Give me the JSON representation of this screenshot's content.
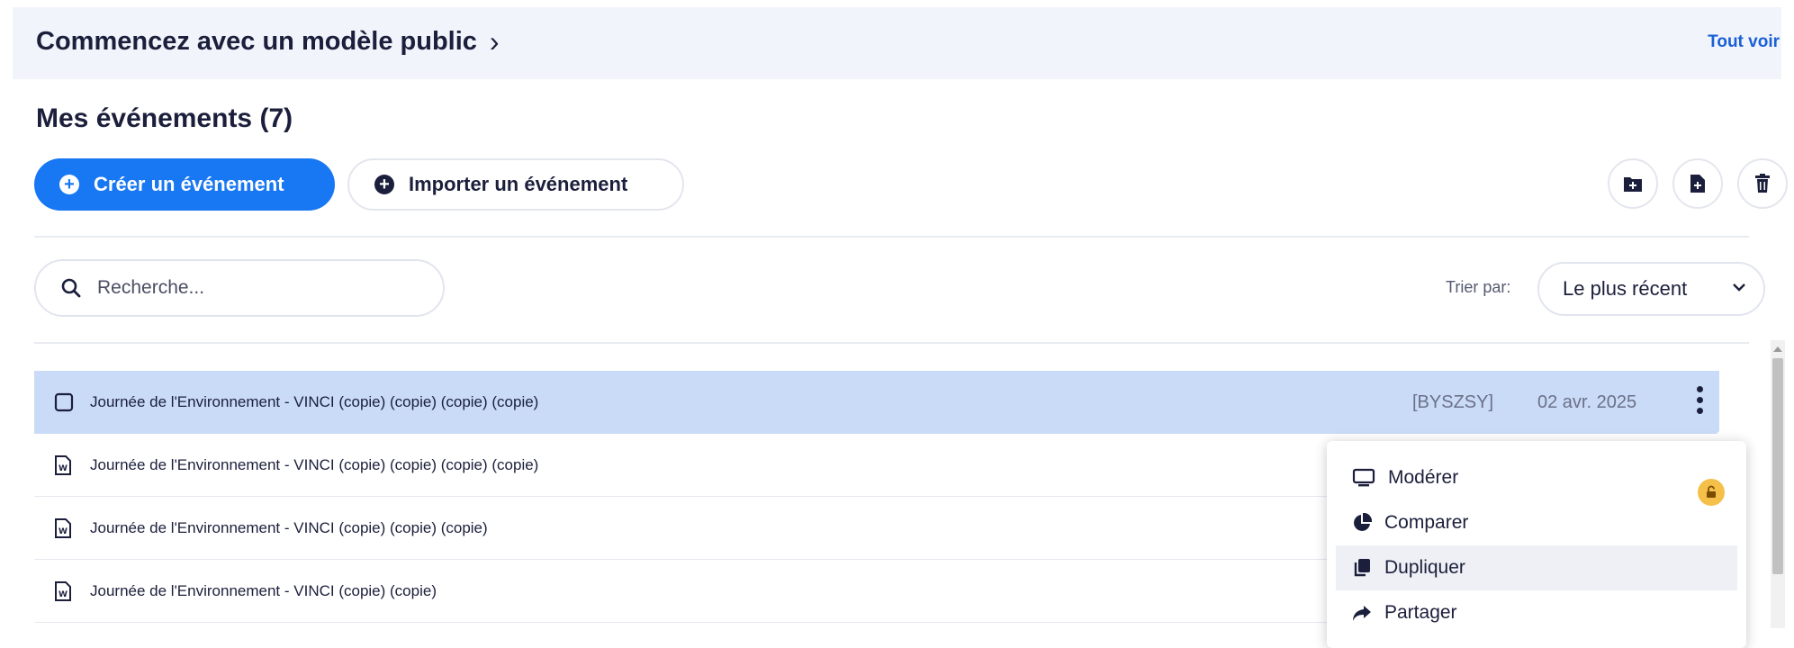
{
  "banner": {
    "title": "Commencez avec un modèle public",
    "see_all": "Tout voir"
  },
  "events": {
    "title": "Mes événements (7)",
    "create_label": "Créer un événement",
    "import_label": "Importer un événement"
  },
  "search": {
    "placeholder": "Recherche..."
  },
  "sort": {
    "label": "Trier par:",
    "value": "Le plus récent"
  },
  "rows": [
    {
      "name": "Journée de l'Environnement - VINCI (copie) (copie) (copie) (copie)",
      "code": "[BYSZSY]",
      "date": "02 avr. 2025"
    },
    {
      "name": "Journée de l'Environnement - VINCI (copie) (copie) (copie) (copie)"
    },
    {
      "name": "Journée de l'Environnement - VINCI (copie) (copie) (copie)"
    },
    {
      "name": "Journée de l'Environnement - VINCI (copie) (copie)"
    }
  ],
  "menu": {
    "items": [
      {
        "label": "Modérer",
        "icon": "monitor-icon"
      },
      {
        "label": "Comparer",
        "icon": "pie-chart-icon"
      },
      {
        "label": "Dupliquer",
        "icon": "copy-icon"
      },
      {
        "label": "Partager",
        "icon": "share-arrow-icon"
      }
    ]
  },
  "colors": {
    "accent": "#1877f2",
    "selected_row": "#c9dbf7",
    "banner_bg": "#f1f4fb",
    "lock_badge": "#f4c04a"
  }
}
